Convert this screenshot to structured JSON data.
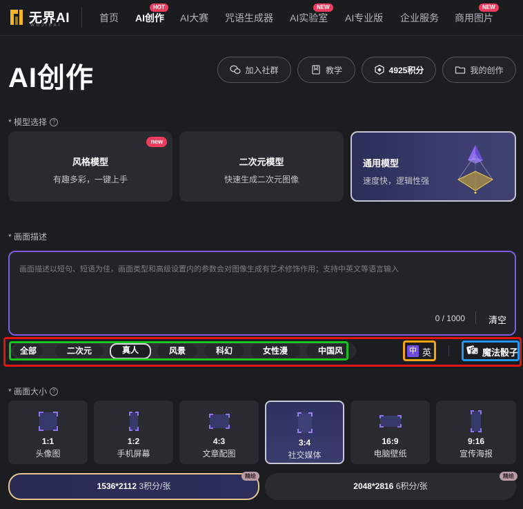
{
  "brand": {
    "name": "无界AI",
    "sub": "WUJIEAI"
  },
  "nav": {
    "items": [
      {
        "label": "首页"
      },
      {
        "label": "AI创作",
        "badge": "HOT"
      },
      {
        "label": "AI大赛"
      },
      {
        "label": "咒语生成器"
      },
      {
        "label": "AI实验室",
        "badge": "NEW"
      },
      {
        "label": "AI专业版"
      },
      {
        "label": "企业服务"
      },
      {
        "label": "商用图片",
        "badge": "NEW"
      }
    ]
  },
  "page": {
    "title": "AI创作"
  },
  "actions": {
    "join": "加入社群",
    "tutorial": "教学",
    "points": "4925积分",
    "my_works": "我的创作"
  },
  "model_section": {
    "label": "* 模型选择",
    "cards": [
      {
        "title": "风格模型",
        "desc": "有趣多彩，一键上手",
        "tag": "new"
      },
      {
        "title": "二次元模型",
        "desc": "快速生成二次元图像"
      },
      {
        "title": "通用模型",
        "desc": "速度快，逻辑性强"
      }
    ]
  },
  "prompt_section": {
    "label": "* 画面描述",
    "placeholder": "画面描述以短句、短语为佳，画面类型和高级设置内的参数会对图像生成有艺术修饰作用；支持中英文等语言输入",
    "count": "0 / 1000",
    "clear": "清空"
  },
  "style_tags": [
    "全部",
    "二次元",
    "真人",
    "风景",
    "科幻",
    "女性漫",
    "中国风"
  ],
  "language": {
    "zh": "中",
    "en": "英"
  },
  "dice": {
    "label": "魔法骰子"
  },
  "size_section": {
    "label": "* 画面大小",
    "cards": [
      {
        "ratio": "1:1",
        "name": "头像图"
      },
      {
        "ratio": "1:2",
        "name": "手机屏幕"
      },
      {
        "ratio": "4:3",
        "name": "文章配图"
      },
      {
        "ratio": "3:4",
        "name": "社交媒体"
      },
      {
        "ratio": "16:9",
        "name": "电脑壁纸"
      },
      {
        "ratio": "9:16",
        "name": "宣传海报"
      }
    ]
  },
  "resolution": [
    {
      "size": "1536*2112",
      "points": "3积分/张",
      "tag": "精绘"
    },
    {
      "size": "2048*2816",
      "points": "6积分/张",
      "tag": "精绘"
    }
  ],
  "colors": {
    "accent_purple": "#7f5be0",
    "badge_red": "#ec3d5e",
    "gold": "#e7c58e"
  }
}
